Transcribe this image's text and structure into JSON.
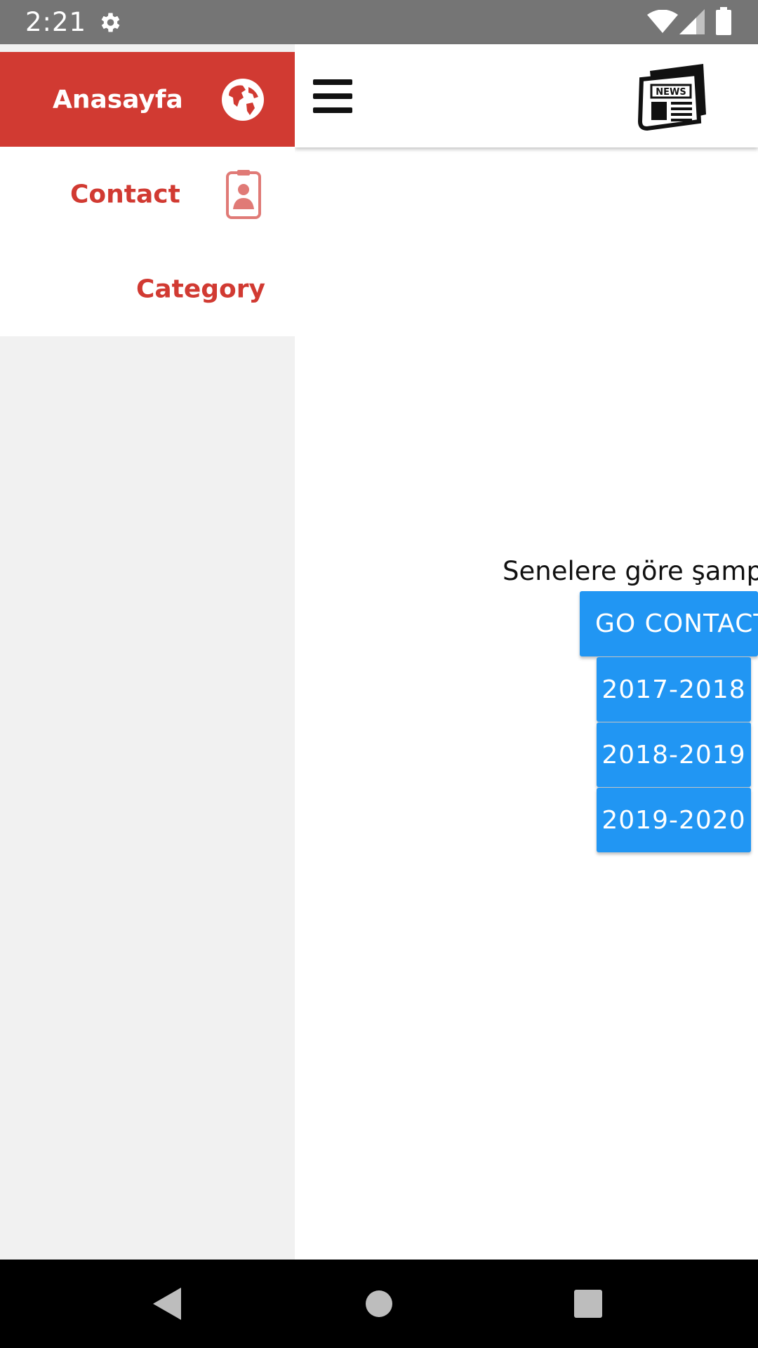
{
  "status_bar": {
    "time": "2:21"
  },
  "drawer": {
    "items": [
      {
        "label": "Anasayfa",
        "icon": "globe-icon",
        "active": true
      },
      {
        "label": "Contact",
        "icon": "contact-card-icon",
        "active": false
      },
      {
        "label": "Category",
        "active": false
      }
    ]
  },
  "app_bar": {
    "menu_icon": "hamburger-menu-icon",
    "logo_icon": "news-icon",
    "logo_text": "NEWS"
  },
  "main": {
    "title": "Senelere göre şampiyo",
    "contact_button": "GO CONTACT",
    "year_buttons": [
      "2017-2018",
      "2018-2019",
      "2019-2020"
    ]
  },
  "colors": {
    "drawer_accent": "#d13a32",
    "button_blue": "#2196f3",
    "status_bar": "#757575"
  }
}
